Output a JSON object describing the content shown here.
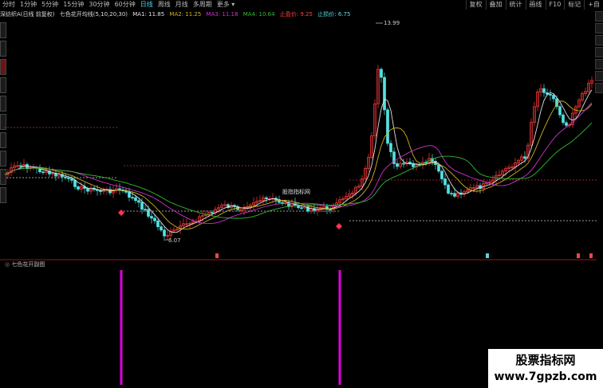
{
  "toolbar": {
    "periods": [
      "分时",
      "1分钟",
      "5分钟",
      "15分钟",
      "30分钟",
      "60分钟",
      "日线",
      "周线",
      "月线",
      "多周期",
      "更多"
    ],
    "active_period": "日线",
    "tools": [
      "复权",
      "叠加",
      "统计",
      "画线",
      "F10",
      "标记",
      "+自"
    ]
  },
  "info": {
    "stock": "深纺织A(日线 前复权)",
    "indicator": "七色花开均线(5,10,20,30)",
    "ma1": "MA1: 11.85",
    "ma2": "MA2: 11.25",
    "ma3": "MA3: 11.18",
    "ma4": "MA4: 10.64",
    "take_profit": "止盈价: 9.25",
    "stop_loss": "止损价: 6.75"
  },
  "chart_labels": {
    "high": "13.99",
    "low": "6.07",
    "center": "股指指标网"
  },
  "subchart": {
    "title": "七色花开副图"
  },
  "watermark": {
    "line1": "股票指标网",
    "line2": "www.7gpzb.com"
  },
  "colors": {
    "up": "#ff3b3b",
    "down": "#55e0e0",
    "ma1": "#e0e0e0",
    "ma2": "#d0b020",
    "ma3": "#cc33cc",
    "ma4": "#33bb33",
    "signal": "#e000e0"
  },
  "chart_data": {
    "type": "candlestick",
    "title": "深纺织A(日线 前复权)",
    "marked_high": 13.99,
    "marked_low": 6.07,
    "take_profit": 9.25,
    "stop_loss": 6.75,
    "ma_latest": {
      "MA1": 11.85,
      "MA2": 11.25,
      "MA3": 11.18,
      "MA4": 10.64
    },
    "signal_bars_count": 2
  }
}
